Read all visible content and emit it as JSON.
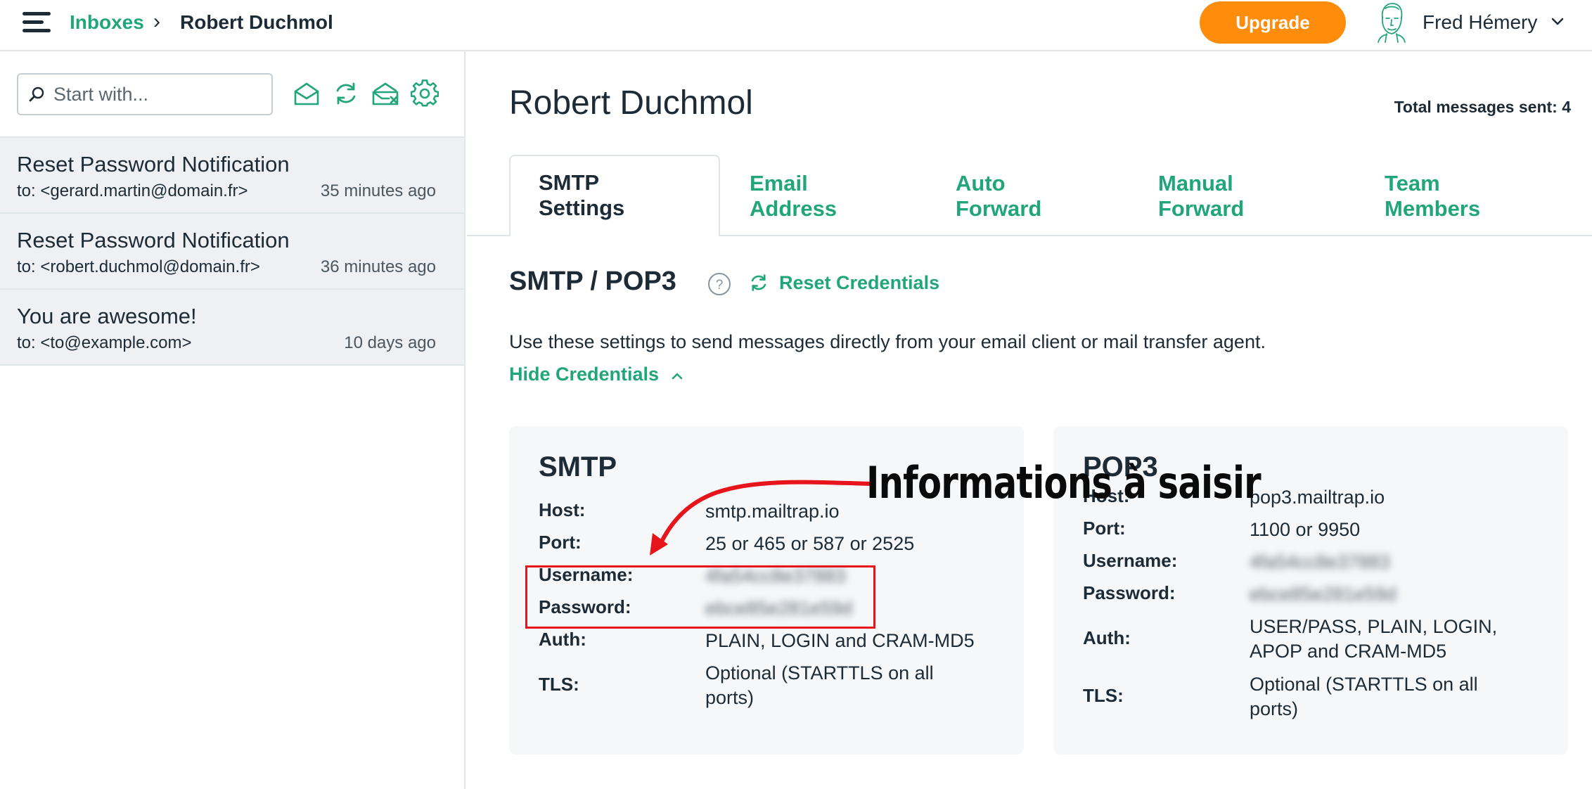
{
  "header": {
    "breadcrumb_link": "Inboxes",
    "breadcrumb_separator": "›",
    "breadcrumb_current": "Robert Duchmol",
    "upgrade_label": "Upgrade",
    "user_name": "Fred Hémery"
  },
  "sidebar": {
    "search_placeholder": "Start with...",
    "messages": [
      {
        "subject": "Reset Password Notification",
        "to": "to: <gerard.martin@domain.fr>",
        "time": "35 minutes ago"
      },
      {
        "subject": "Reset Password Notification",
        "to": "to: <robert.duchmol@domain.fr>",
        "time": "36 minutes ago"
      },
      {
        "subject": "You are awesome!",
        "to": "to: <to@example.com>",
        "time": "10 days ago"
      }
    ]
  },
  "main": {
    "title": "Robert Duchmol",
    "total_sent": "Total messages sent: 4",
    "tabs": [
      {
        "line1": "SMTP",
        "line2": "Settings",
        "active": true
      },
      {
        "line1": "Email",
        "line2": "Address"
      },
      {
        "line1": "Auto",
        "line2": "Forward"
      },
      {
        "line1": "Manual",
        "line2": "Forward"
      },
      {
        "line1": "Team",
        "line2": "Members"
      }
    ],
    "section_title": "SMTP / POP3",
    "help_glyph": "?",
    "reset_credentials": "Reset Credentials",
    "description": "Use these settings to send messages directly from your email client or mail transfer agent.",
    "hide_credentials": "Hide Credentials",
    "smtp": {
      "title": "SMTP",
      "host_label": "Host:",
      "host": "smtp.mailtrap.io",
      "port_label": "Port:",
      "port": "25 or 465 or 587 or 2525",
      "username_label": "Username:",
      "username": "4fa54cc8e37883",
      "password_label": "Password:",
      "password": "ebce85e281e59d",
      "auth_label": "Auth:",
      "auth": "PLAIN, LOGIN and CRAM-MD5",
      "tls_label": "TLS:",
      "tls": "Optional (STARTTLS on all ports)"
    },
    "pop3": {
      "title": "POP3",
      "host_label": "Host:",
      "host": "pop3.mailtrap.io",
      "port_label": "Port:",
      "port": "1100 or 9950",
      "username_label": "Username:",
      "username": "4fa54cc8e37883",
      "password_label": "Password:",
      "password": "ebce85e281e59d",
      "auth_label": "Auth:",
      "auth": "USER/PASS, PLAIN, LOGIN, APOP and CRAM-MD5",
      "tls_label": "TLS:",
      "tls": "Optional (STARTTLS on all ports)"
    }
  },
  "annotation": {
    "text": "Informations à saisir",
    "color": "#e8141c"
  },
  "colors": {
    "accent": "#20a67a",
    "upgrade": "#ff8c0a",
    "text": "#1d2b36",
    "list_bg": "#eef0f4",
    "card_bg": "#f5f7f9"
  },
  "icons": {
    "menu": "hamburger-menu-icon",
    "search": "search-icon",
    "mark_read": "open-envelope-icon",
    "refresh": "refresh-icon",
    "clear_inbox": "clear-inbox-icon",
    "settings": "gear-icon",
    "help": "help-circle-icon",
    "reset": "refresh-icon",
    "user_menu": "chevron-down-icon",
    "hide": "chevron-up-icon"
  }
}
